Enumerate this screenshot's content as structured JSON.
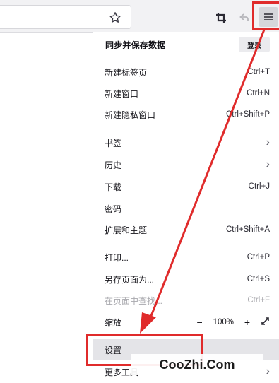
{
  "toolbar": {
    "icons": [
      "star-icon",
      "screenshot-crop-icon",
      "back-icon",
      "hamburger-menu-icon"
    ]
  },
  "menu": {
    "sync_label": "同步并保存数据",
    "login_label": "登录",
    "new_tab": {
      "label": "新建标签页",
      "shortcut": "Ctrl+T"
    },
    "new_window": {
      "label": "新建窗口",
      "shortcut": "Ctrl+N"
    },
    "new_private": {
      "label": "新建隐私窗口",
      "shortcut": "Ctrl+Shift+P"
    },
    "bookmarks": {
      "label": "书签"
    },
    "history": {
      "label": "历史"
    },
    "downloads": {
      "label": "下载",
      "shortcut": "Ctrl+J"
    },
    "passwords": {
      "label": "密码"
    },
    "addons": {
      "label": "扩展和主题",
      "shortcut": "Ctrl+Shift+A"
    },
    "print": {
      "label": "打印...",
      "shortcut": "Ctrl+P"
    },
    "save_page": {
      "label": "另存页面为...",
      "shortcut": "Ctrl+S"
    },
    "find": {
      "label": "在页面中查找...",
      "shortcut": "Ctrl+F"
    },
    "zoom": {
      "label": "缩放",
      "minus": "−",
      "value": "100%",
      "plus": "+"
    },
    "settings": {
      "label": "设置"
    },
    "more_tools": {
      "label": "更多工具"
    }
  },
  "watermark": "CooZhi.Com",
  "colors": {
    "annotation_red": "#e02b2b",
    "toolbar_bg": "#f2f2f4",
    "menu_button_bg": "#d6d6da",
    "settings_highlight_bg": "#e4e4e8"
  }
}
